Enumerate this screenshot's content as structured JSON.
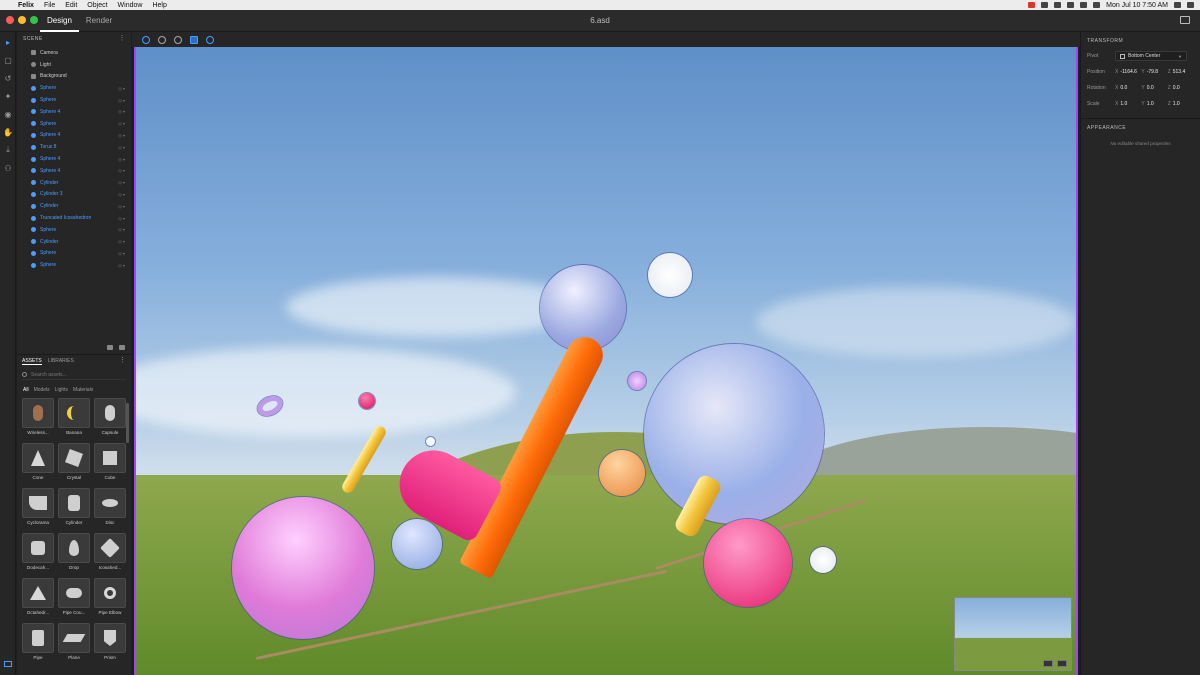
{
  "menubar": {
    "app": "Felix",
    "items": [
      "File",
      "Edit",
      "Object",
      "Window",
      "Help"
    ],
    "clock": "Mon Jul 10  7:50 AM"
  },
  "titlebar": {
    "tabs": [
      "Design",
      "Render"
    ],
    "document": "6.asd"
  },
  "scene": {
    "header": "SCENE",
    "env_items": [
      "Camera",
      "Light",
      "Background"
    ],
    "objects": [
      "Sphere",
      "Sphere",
      "Sphere 4",
      "Sphere",
      "Sphere 4",
      "Torus 8",
      "Sphere 4",
      "Sphere 4",
      "Cylinder",
      "Cylinder 3",
      "Cylinder",
      "Truncated Icosahedron",
      "Sphere",
      "Cylinder",
      "Sphere",
      "Sphere"
    ]
  },
  "assets": {
    "tabs": [
      "ASSETS",
      "LIBRARIES"
    ],
    "search_placeholder": "Search assets...",
    "filters": [
      "All",
      "Models",
      "Lights",
      "Materials"
    ],
    "items": [
      "Wireless...",
      "Banana",
      "Capsule",
      "Cone",
      "Crystal",
      "Cube",
      "Cyclorama",
      "Cylinder",
      "Disc",
      "Dodecah...",
      "Drop",
      "Icosahed...",
      "Octahedr...",
      "Pipe Cou...",
      "Pipe Elbow",
      "Pipe",
      "Plane",
      "Prism"
    ]
  },
  "properties": {
    "transform_header": "TRANSFORM",
    "pivot_label": "Pivot",
    "pivot_value": "Bottom Center",
    "position_label": "Position",
    "position": {
      "x": "-1164.6",
      "y": "-79.8",
      "z": "513.4"
    },
    "rotation_label": "Rotation",
    "rotation": {
      "x": "0.0",
      "y": "0.0",
      "z": "0.0"
    },
    "scale_label": "Scale",
    "scale": {
      "x": "1.0",
      "y": "1.0",
      "z": "1.0"
    },
    "appearance_header": "APPEARANCE",
    "appearance_note": "No editable shared properties"
  },
  "colors": {
    "accent": "#4a9eff",
    "viewport_border": "#a044ff"
  }
}
